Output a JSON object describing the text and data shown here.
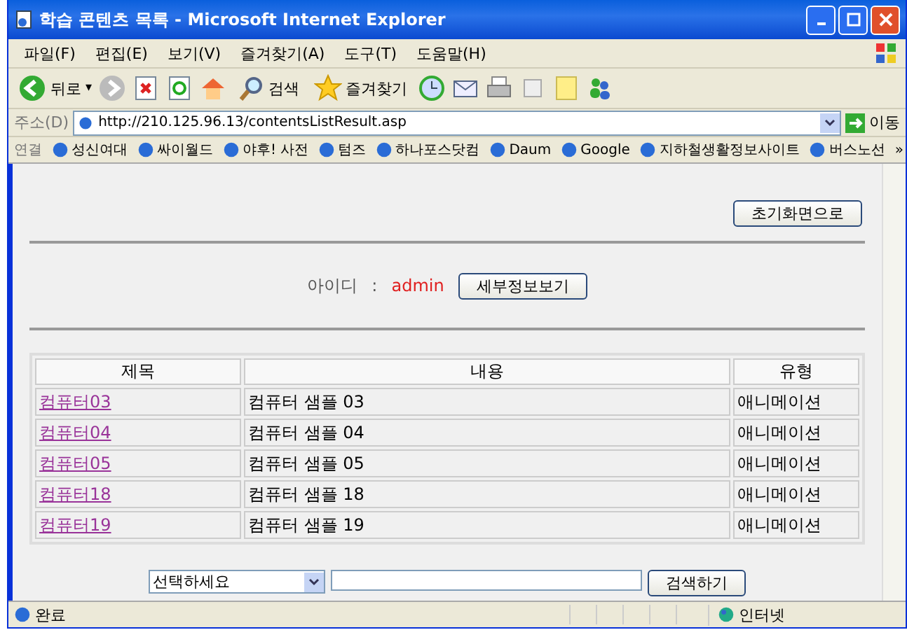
{
  "window": {
    "title": "학습 콘텐츠 목록 - Microsoft Internet Explorer"
  },
  "menu": [
    "파일(F)",
    "편집(E)",
    "보기(V)",
    "즐겨찾기(A)",
    "도구(T)",
    "도움말(H)"
  ],
  "toolbar": {
    "back": "뒤로",
    "back_menu": "▾",
    "search": "검색",
    "favorites": "즐겨찾기"
  },
  "address": {
    "label": "주소(D)",
    "url": "http://210.125.96.13/contentsListResult.asp",
    "go": "이동"
  },
  "links": {
    "label": "연결",
    "items": [
      "성신여대",
      "싸이월드",
      "야후! 사전",
      "텀즈",
      "하나포스닷컴",
      "Daum",
      "Google",
      "지하철생활정보사이트",
      "버스노선"
    ],
    "more": "»"
  },
  "page": {
    "reset_button": "초기화면으로",
    "id_label": "아이디",
    "id_separator": ":",
    "id_value": "admin",
    "detail_button": "세부정보보기",
    "table": {
      "columns": [
        "제목",
        "내용",
        "유형"
      ],
      "rows": [
        {
          "title": "컴퓨터03",
          "content": "컴퓨터 샘플 03",
          "type": "애니메이션"
        },
        {
          "title": "컴퓨터04",
          "content": "컴퓨터 샘플 04",
          "type": "애니메이션"
        },
        {
          "title": "컴퓨터05",
          "content": "컴퓨터 샘플 05",
          "type": "애니메이션"
        },
        {
          "title": "컴퓨터18",
          "content": "컴퓨터 샘플 18",
          "type": "애니메이션"
        },
        {
          "title": "컴퓨터19",
          "content": "컴퓨터 샘플 19",
          "type": "애니메이션"
        }
      ]
    },
    "search": {
      "select": "선택하세요",
      "button": "검색하기"
    }
  },
  "status_bar": {
    "text": "완료",
    "zone": "인터넷"
  }
}
